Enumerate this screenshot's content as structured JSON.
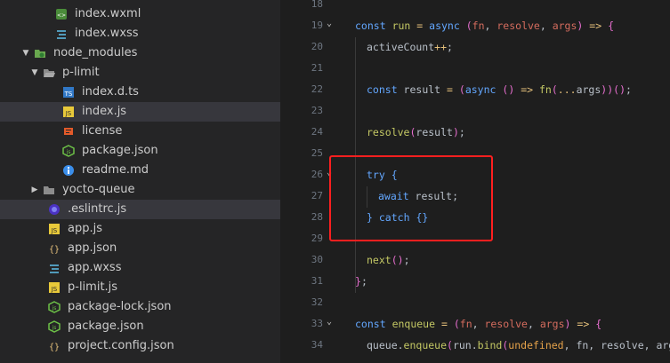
{
  "explorer": {
    "items": [
      {
        "label": "index.wxml",
        "icon": "wxml-icon",
        "indent": 62,
        "chev": ""
      },
      {
        "label": "index.wxss",
        "icon": "css-icon",
        "indent": 62,
        "chev": ""
      },
      {
        "label": "node_modules",
        "icon": "folder-green-icon",
        "indent": 38,
        "chev": "down"
      },
      {
        "label": "p-limit",
        "icon": "folder-open-icon",
        "indent": 48,
        "chev": "down"
      },
      {
        "label": "index.d.ts",
        "icon": "ts-icon",
        "indent": 70,
        "chev": ""
      },
      {
        "label": "index.js",
        "icon": "js-icon",
        "indent": 70,
        "chev": "",
        "selected": true
      },
      {
        "label": "license",
        "icon": "license-icon",
        "indent": 70,
        "chev": ""
      },
      {
        "label": "package.json",
        "icon": "node-icon",
        "indent": 70,
        "chev": ""
      },
      {
        "label": "readme.md",
        "icon": "info-icon",
        "indent": 70,
        "chev": ""
      },
      {
        "label": "yocto-queue",
        "icon": "folder-icon",
        "indent": 48,
        "chev": "right"
      },
      {
        "label": ".eslintrc.js",
        "icon": "eslint-icon",
        "indent": 54,
        "chev": "",
        "selected": true
      },
      {
        "label": "app.js",
        "icon": "js-icon",
        "indent": 54,
        "chev": ""
      },
      {
        "label": "app.json",
        "icon": "json-icon",
        "indent": 54,
        "chev": ""
      },
      {
        "label": "app.wxss",
        "icon": "css-icon",
        "indent": 54,
        "chev": ""
      },
      {
        "label": "p-limit.js",
        "icon": "js-icon",
        "indent": 54,
        "chev": ""
      },
      {
        "label": "package-lock.json",
        "icon": "node-icon",
        "indent": 54,
        "chev": ""
      },
      {
        "label": "package.json",
        "icon": "node-icon",
        "indent": 54,
        "chev": ""
      },
      {
        "label": "project.config.json",
        "icon": "json-icon",
        "indent": 54,
        "chev": ""
      }
    ]
  },
  "editor": {
    "lines": [
      {
        "n": "18",
        "fold": false,
        "indent": 0,
        "tokens": []
      },
      {
        "n": "19",
        "fold": true,
        "indent": 0,
        "tokens": [
          [
            "kw",
            "const"
          ],
          [
            "vr",
            " "
          ],
          [
            "fn",
            "run"
          ],
          [
            "vr",
            " "
          ],
          [
            "op",
            "="
          ],
          [
            "vr",
            " "
          ],
          [
            "kw",
            "async"
          ],
          [
            "vr",
            " "
          ],
          [
            "pn",
            "("
          ],
          [
            "pm",
            "fn"
          ],
          [
            "vr",
            ", "
          ],
          [
            "pm",
            "resolve"
          ],
          [
            "vr",
            ", "
          ],
          [
            "pm",
            "args"
          ],
          [
            "pn",
            ")"
          ],
          [
            "vr",
            " "
          ],
          [
            "op",
            "=>"
          ],
          [
            "vr",
            " "
          ],
          [
            "pn",
            "{"
          ]
        ]
      },
      {
        "n": "20",
        "fold": false,
        "indent": 1,
        "tokens": [
          [
            "vr",
            "activeCount"
          ],
          [
            "op",
            "++"
          ],
          [
            "vr",
            ";"
          ]
        ]
      },
      {
        "n": "21",
        "fold": false,
        "indent": 1,
        "tokens": []
      },
      {
        "n": "22",
        "fold": false,
        "indent": 1,
        "tokens": [
          [
            "kw",
            "const"
          ],
          [
            "vr",
            " result "
          ],
          [
            "op",
            "="
          ],
          [
            "vr",
            " "
          ],
          [
            "pn",
            "("
          ],
          [
            "kw",
            "async"
          ],
          [
            "vr",
            " "
          ],
          [
            "pn",
            "()"
          ],
          [
            "vr",
            " "
          ],
          [
            "op",
            "=>"
          ],
          [
            "vr",
            " "
          ],
          [
            "fn",
            "fn"
          ],
          [
            "pn",
            "("
          ],
          [
            "op",
            "..."
          ],
          [
            "vr",
            "args"
          ],
          [
            "pn",
            ")"
          ],
          [
            "pn",
            ")"
          ],
          [
            "pn",
            "()"
          ],
          [
            "vr",
            ";"
          ]
        ]
      },
      {
        "n": "23",
        "fold": false,
        "indent": 1,
        "tokens": []
      },
      {
        "n": "24",
        "fold": false,
        "indent": 1,
        "tokens": [
          [
            "fn",
            "resolve"
          ],
          [
            "pn",
            "("
          ],
          [
            "vr",
            "result"
          ],
          [
            "pn",
            ")"
          ],
          [
            "vr",
            ";"
          ]
        ]
      },
      {
        "n": "25",
        "fold": false,
        "indent": 1,
        "tokens": []
      },
      {
        "n": "26",
        "fold": true,
        "indent": 1,
        "tokens": [
          [
            "kw",
            "try"
          ],
          [
            "vr",
            " "
          ],
          [
            "kw",
            "{"
          ]
        ]
      },
      {
        "n": "27",
        "fold": false,
        "indent": 2,
        "tokens": [
          [
            "kw",
            "await"
          ],
          [
            "vr",
            " result;"
          ]
        ]
      },
      {
        "n": "28",
        "fold": false,
        "indent": 1,
        "tokens": [
          [
            "kw",
            "}"
          ],
          [
            "vr",
            " "
          ],
          [
            "kw",
            "catch"
          ],
          [
            "vr",
            " "
          ],
          [
            "kw",
            "{}"
          ]
        ]
      },
      {
        "n": "29",
        "fold": false,
        "indent": 1,
        "tokens": []
      },
      {
        "n": "30",
        "fold": false,
        "indent": 1,
        "tokens": [
          [
            "fn",
            "next"
          ],
          [
            "pn",
            "()"
          ],
          [
            "vr",
            ";"
          ]
        ]
      },
      {
        "n": "31",
        "fold": false,
        "indent": 0,
        "tokens": [
          [
            "pn",
            "}"
          ],
          [
            "vr",
            ";"
          ]
        ]
      },
      {
        "n": "32",
        "fold": false,
        "indent": 0,
        "tokens": []
      },
      {
        "n": "33",
        "fold": true,
        "indent": 0,
        "tokens": [
          [
            "kw",
            "const"
          ],
          [
            "vr",
            " "
          ],
          [
            "fn",
            "enqueue"
          ],
          [
            "vr",
            " "
          ],
          [
            "op",
            "="
          ],
          [
            "vr",
            " "
          ],
          [
            "pn",
            "("
          ],
          [
            "pm",
            "fn"
          ],
          [
            "vr",
            ", "
          ],
          [
            "pm",
            "resolve"
          ],
          [
            "vr",
            ", "
          ],
          [
            "pm",
            "args"
          ],
          [
            "pn",
            ")"
          ],
          [
            "vr",
            " "
          ],
          [
            "op",
            "=>"
          ],
          [
            "vr",
            " "
          ],
          [
            "pn",
            "{"
          ]
        ]
      },
      {
        "n": "34",
        "fold": false,
        "indent": 1,
        "tokens": [
          [
            "vr",
            "queue."
          ],
          [
            "fn",
            "enqueue"
          ],
          [
            "pn",
            "("
          ],
          [
            "vr",
            "run."
          ],
          [
            "fn",
            "bind"
          ],
          [
            "pn",
            "("
          ],
          [
            "und",
            "undefined"
          ],
          [
            "vr",
            ", fn, resolve, args"
          ],
          [
            "pn",
            ")"
          ]
        ]
      }
    ]
  }
}
